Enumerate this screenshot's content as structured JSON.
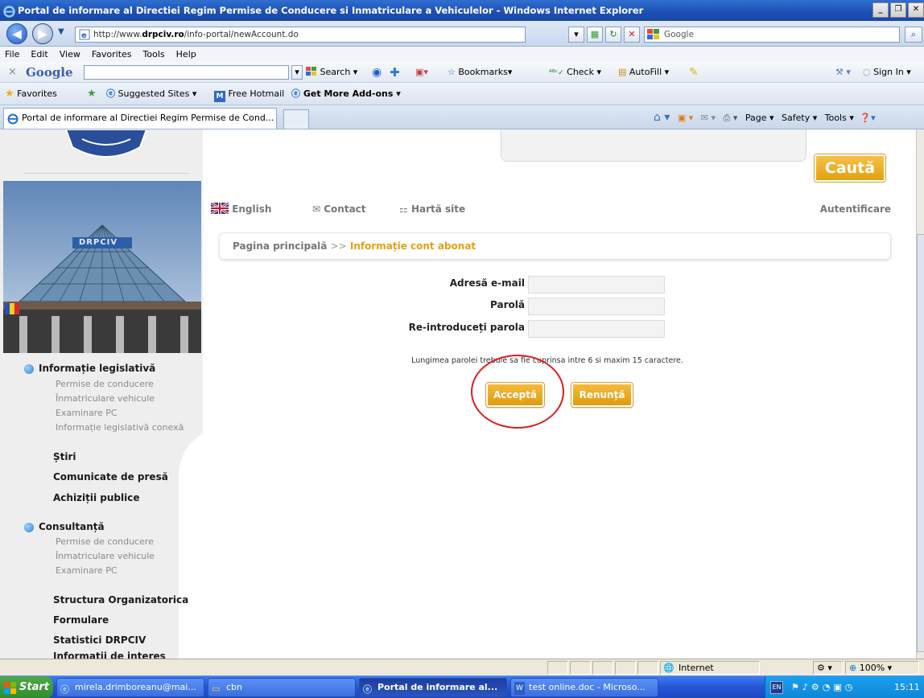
{
  "window": {
    "title": "Portal de informare al Directiei Regim Permise de Conducere si Inmatriculare a Vehiculelor - Windows Internet Explorer",
    "controls": [
      "_",
      "❐",
      "✕"
    ]
  },
  "address_bar": {
    "url_prefix": "http://www.",
    "url_domain": "drpciv.ro",
    "url_path": "/info-portal/newAccount.do",
    "search_placeholder": "Google"
  },
  "menu": [
    "File",
    "Edit",
    "View",
    "Favorites",
    "Tools",
    "Help"
  ],
  "google_toolbar": {
    "logo": "Google",
    "search_label": "Search ▾",
    "bookmarks_label": "Bookmarks▾",
    "check_label": "Check ▾",
    "autofill_label": "AutoFill ▾",
    "signin_label": "Sign In ▾"
  },
  "favorites_bar": {
    "favorites_label": "Favorites",
    "suggested_label": "Suggested Sites ▾",
    "hotmail_label": "Free Hotmail",
    "addons_label": "Get More Add-ons ▾"
  },
  "tabs": [
    {
      "label": "Portal de informare al Directiei Regim Permise de Cond..."
    }
  ],
  "tab_tools": {
    "page": "Page ▾",
    "safety": "Safety ▾",
    "tools": "Tools ▾"
  },
  "page": {
    "search_button": "Caută",
    "links": {
      "english": "English",
      "contact": "Contact",
      "sitemap": "Hartă site",
      "login": "Autentificare"
    },
    "breadcrumb": {
      "home": "Pagina principală",
      "separator": ">>",
      "current": "Informație cont abonat"
    },
    "form": {
      "email_label": "Adresă e-mail",
      "password_label": "Parolă",
      "repassword_label": "Re-introduceți parola",
      "email_value": "",
      "password_value": "",
      "repassword_value": "",
      "note": "Lungimea parolei trebuie sa fie cuprinsa intre 6 si maxim 15 caractere.",
      "accept_button": "Acceptă",
      "cancel_button": "Renunță"
    }
  },
  "sidebar": {
    "building_sign": "DRPCIV",
    "sections": [
      {
        "title": "Informație legislativă",
        "items": [
          "Permise de conducere",
          "Înmatriculare vehicule",
          "Examinare PC",
          "Informație legislativă conexă"
        ]
      },
      {
        "title": "Consultanță",
        "items": [
          "Permise de conducere",
          "Înmatriculare vehicule",
          "Examinare PC"
        ]
      }
    ],
    "links": [
      "Știri",
      "Comunicate de presă",
      "Achiziții publice"
    ],
    "links2": [
      "Structura Organizatorica",
      "Formulare",
      "Statistici DRPCIV",
      "Informații de interes"
    ]
  },
  "status_bar": {
    "zone": "Internet",
    "zoom": "100%"
  },
  "taskbar": {
    "start": "Start",
    "items": [
      {
        "label": "mirela.drimboreanu@mai..."
      },
      {
        "label": "cbn"
      },
      {
        "label": "Portal de informare al..."
      },
      {
        "label": "test online.doc - Microso..."
      }
    ],
    "lang": "EN",
    "clock": "15:11"
  },
  "colors": {
    "accent_orange": "#e3a116",
    "title_blue": "#1d4fb3",
    "annotation_red": "#d81e1e"
  }
}
